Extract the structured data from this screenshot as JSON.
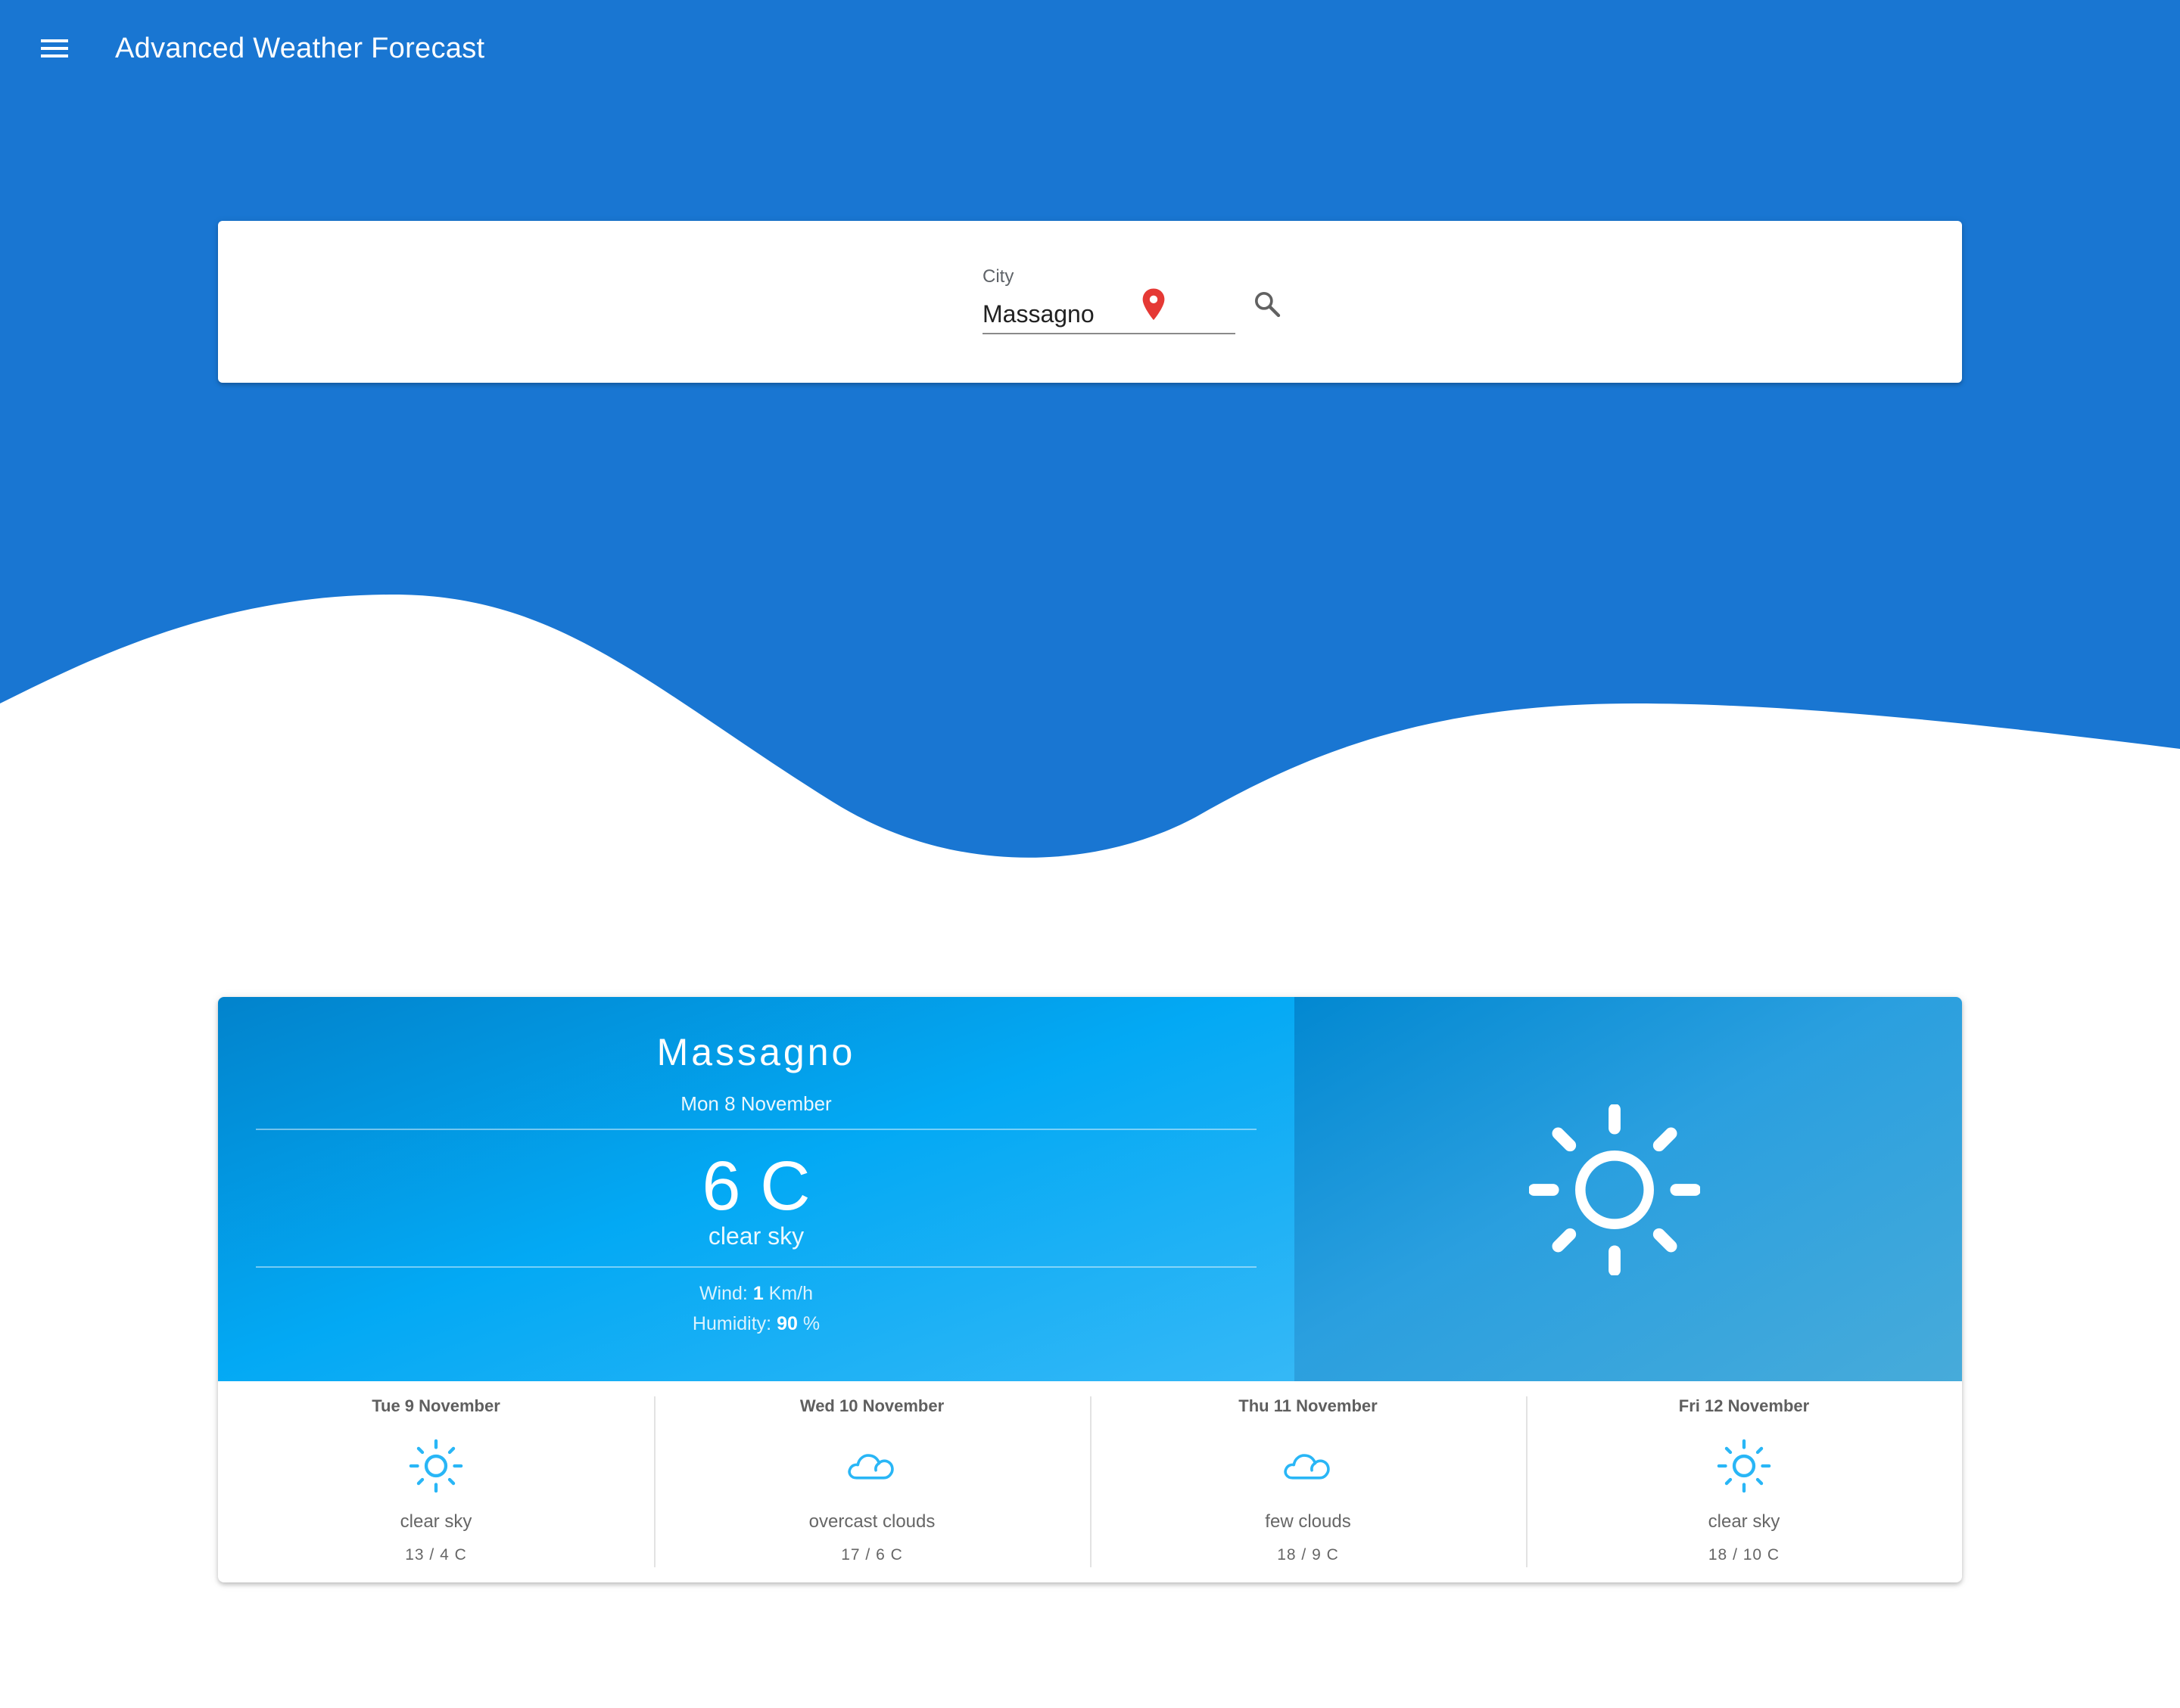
{
  "app": {
    "title": "Advanced Weather Forecast"
  },
  "icons": {
    "menu": "menu-icon",
    "pin": "location-pin-icon",
    "search": "search-icon"
  },
  "search": {
    "label": "City",
    "value": "Massagno"
  },
  "colors": {
    "header_blue": "#1976d2",
    "pin_red": "#e53935",
    "weather_blue": "#03a9f4",
    "icon_blue": "#29b6f6"
  },
  "current": {
    "city": "Massagno",
    "date": "Mon 8 November",
    "temperature": "6 C",
    "description": "clear sky",
    "wind_label": "Wind:",
    "wind_value": "1",
    "wind_unit": "Km/h",
    "humidity_label": "Humidity:",
    "humidity_value": "90",
    "humidity_unit": "%",
    "icon": "sun-icon"
  },
  "forecast": [
    {
      "day": "Tue 9 November",
      "icon": "sun-icon",
      "description": "clear sky",
      "temp": "13 / 4 C"
    },
    {
      "day": "Wed 10 November",
      "icon": "cloud-icon",
      "description": "overcast clouds",
      "temp": "17 / 6 C"
    },
    {
      "day": "Thu 11 November",
      "icon": "cloud-icon",
      "description": "few clouds",
      "temp": "18 / 9 C"
    },
    {
      "day": "Fri 12 November",
      "icon": "sun-icon",
      "description": "clear sky",
      "temp": "18 / 10 C"
    }
  ]
}
